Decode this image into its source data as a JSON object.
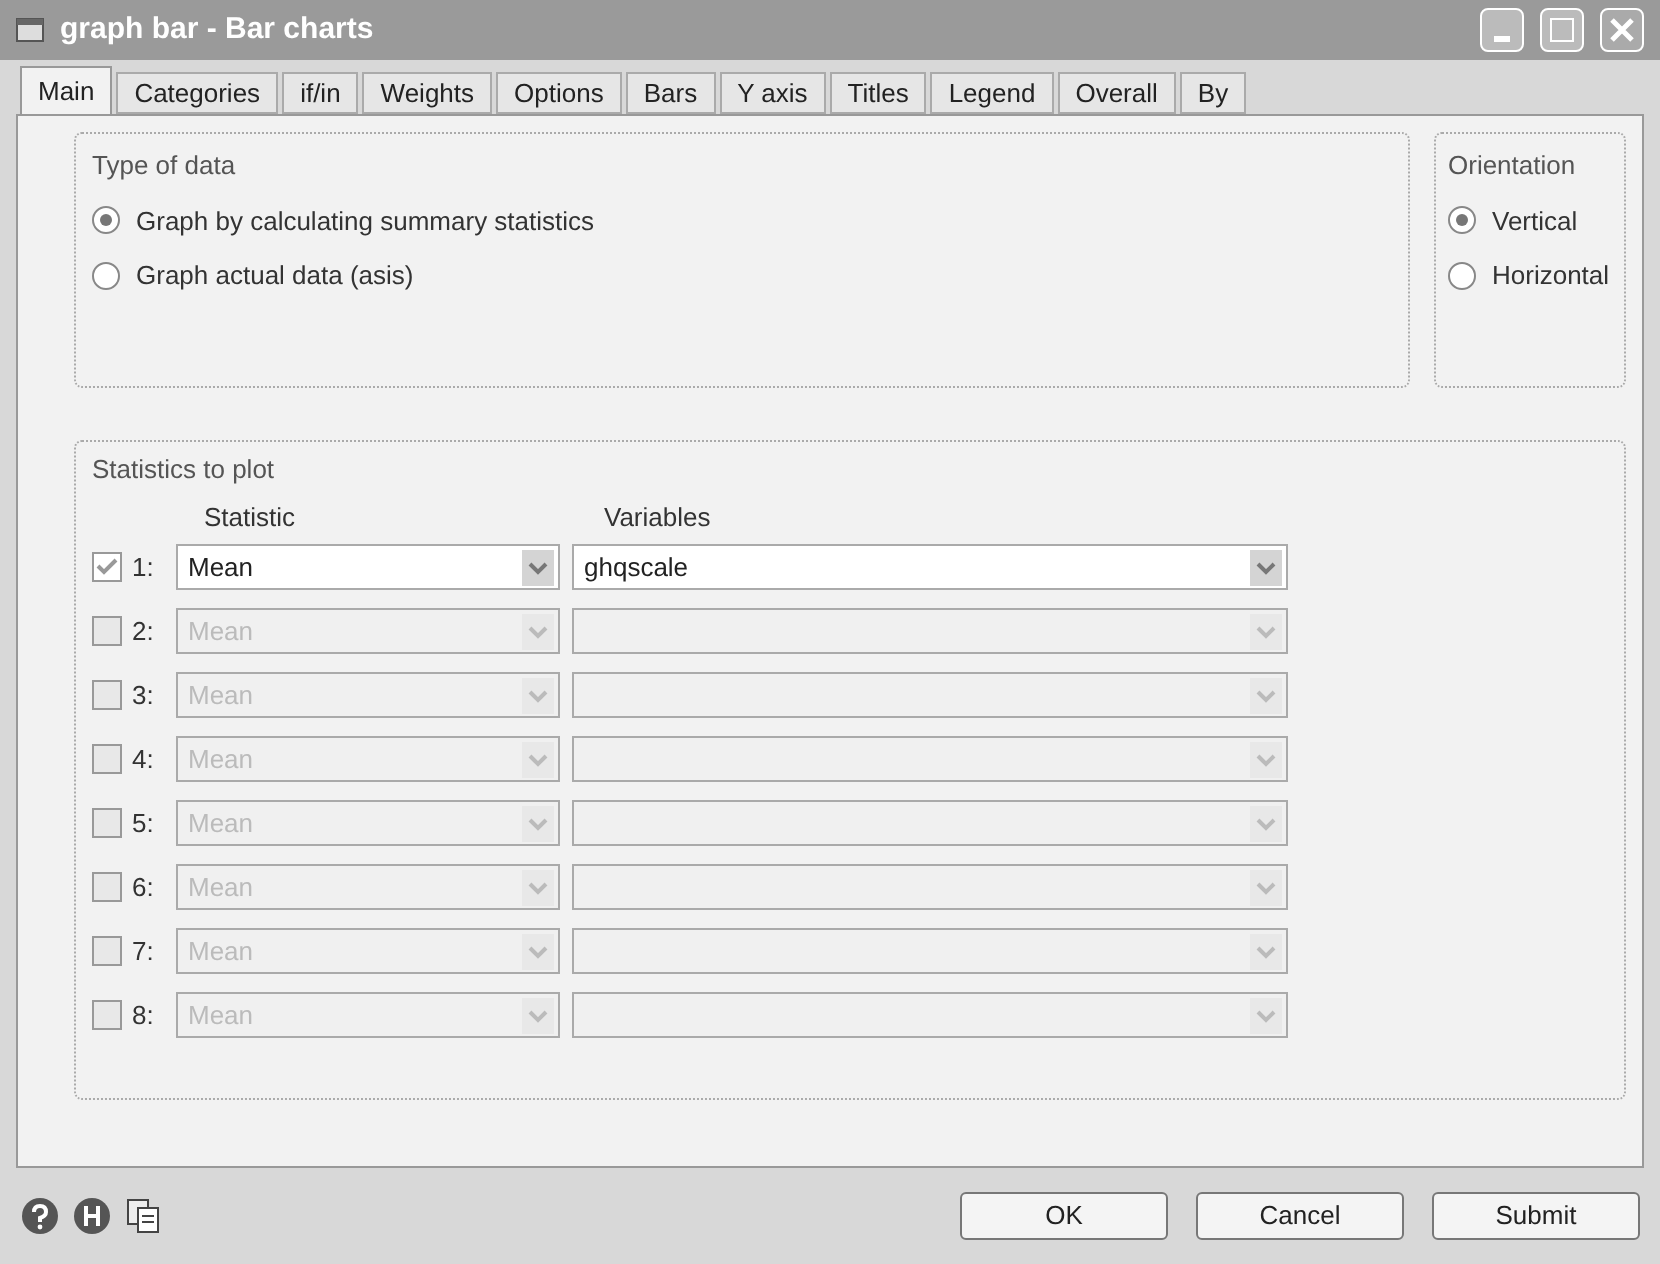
{
  "window": {
    "title": "graph bar - Bar charts"
  },
  "tabs": [
    {
      "label": "Main",
      "selected": true
    },
    {
      "label": "Categories",
      "selected": false
    },
    {
      "label": "if/in",
      "selected": false
    },
    {
      "label": "Weights",
      "selected": false
    },
    {
      "label": "Options",
      "selected": false
    },
    {
      "label": "Bars",
      "selected": false
    },
    {
      "label": "Y axis",
      "selected": false
    },
    {
      "label": "Titles",
      "selected": false
    },
    {
      "label": "Legend",
      "selected": false
    },
    {
      "label": "Overall",
      "selected": false
    },
    {
      "label": "By",
      "selected": false
    }
  ],
  "type_of_data": {
    "title": "Type of data",
    "options": [
      {
        "label": "Graph by calculating summary statistics",
        "selected": true
      },
      {
        "label": "Graph actual data (asis)",
        "selected": false
      }
    ]
  },
  "orientation": {
    "title": "Orientation",
    "options": [
      {
        "label": "Vertical",
        "selected": true
      },
      {
        "label": "Horizontal",
        "selected": false
      }
    ]
  },
  "statistics": {
    "title": "Statistics to plot",
    "statistic_header": "Statistic",
    "variables_header": "Variables",
    "rows": [
      {
        "number": "1:",
        "checked": true,
        "disabled": false,
        "statistic": "Mean",
        "variables": "ghqscale"
      },
      {
        "number": "2:",
        "checked": false,
        "disabled": true,
        "statistic": "Mean"
      },
      {
        "number": "3:",
        "checked": false,
        "disabled": true,
        "statistic": "Mean"
      },
      {
        "number": "4:",
        "checked": false,
        "disabled": true,
        "statistic": "Mean"
      },
      {
        "number": "5:",
        "checked": false,
        "disabled": true,
        "statistic": "Mean"
      },
      {
        "number": "6:",
        "checked": false,
        "disabled": true,
        "statistic": "Mean"
      },
      {
        "number": "7:",
        "checked": false,
        "disabled": true,
        "statistic": "Mean"
      },
      {
        "number": "8:",
        "checked": false,
        "disabled": true,
        "statistic": "Mean"
      }
    ]
  },
  "buttons": [
    "OK",
    "Cancel",
    "Submit"
  ]
}
